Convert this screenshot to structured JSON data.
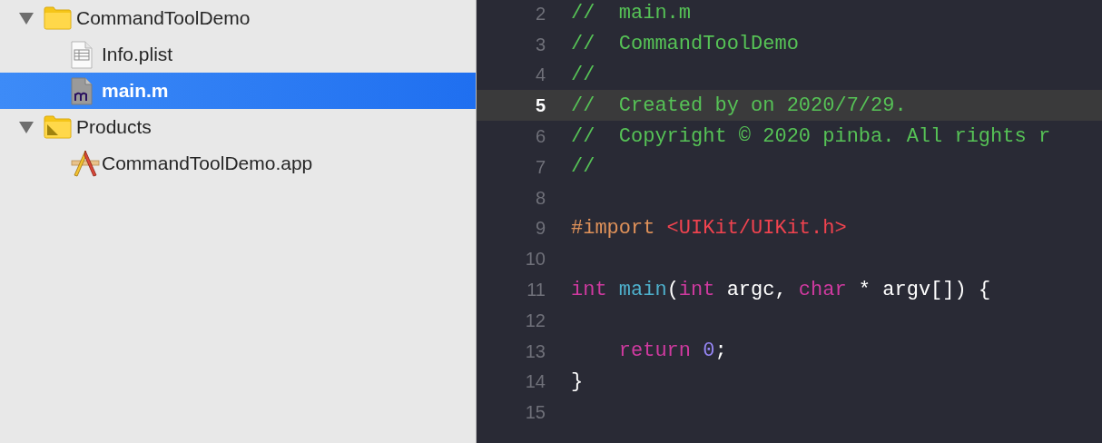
{
  "navigator": {
    "items": [
      {
        "name": "CommandToolDemo",
        "kind": "folder",
        "expanded": true,
        "selected": false,
        "children": [
          {
            "name": "Info.plist",
            "kind": "plist",
            "selected": false
          },
          {
            "name": "main.m",
            "kind": "source",
            "selected": true
          }
        ]
      },
      {
        "name": "Products",
        "kind": "products",
        "expanded": true,
        "selected": false,
        "children": [
          {
            "name": "CommandToolDemo.app",
            "kind": "app",
            "selected": false
          }
        ]
      }
    ]
  },
  "editor": {
    "lines": [
      {
        "number": "2",
        "current": false,
        "tokens": [
          {
            "kind": "comment",
            "text": "//  main.m"
          }
        ]
      },
      {
        "number": "3",
        "current": false,
        "tokens": [
          {
            "kind": "comment",
            "text": "//  CommandToolDemo"
          }
        ]
      },
      {
        "number": "4",
        "current": false,
        "tokens": [
          {
            "kind": "comment",
            "text": "//"
          }
        ]
      },
      {
        "number": "5",
        "current": true,
        "tokens": [
          {
            "kind": "comment",
            "text": "//  Created by on 2020/7/29."
          }
        ]
      },
      {
        "number": "6",
        "current": false,
        "tokens": [
          {
            "kind": "comment",
            "text": "//  Copyright © 2020 pinba. All rights r"
          }
        ]
      },
      {
        "number": "7",
        "current": false,
        "tokens": [
          {
            "kind": "comment",
            "text": "//"
          }
        ]
      },
      {
        "number": "8",
        "current": false
      },
      {
        "number": "9",
        "current": false,
        "tokens": [
          {
            "kind": "preprocessor",
            "text": "#import"
          },
          {
            "kind": "string",
            "text": " <UIKit/UIKit.h>"
          }
        ]
      },
      {
        "number": "10",
        "current": false
      },
      {
        "number": "11",
        "current": false,
        "tokens": [
          {
            "kind": "keyword",
            "text": "int"
          },
          {
            "kind": "function",
            "text": " main"
          },
          {
            "kind": "plain",
            "text": "("
          },
          {
            "kind": "keyword",
            "text": "int"
          },
          {
            "kind": "plain",
            "text": " argc, "
          },
          {
            "kind": "keyword",
            "text": "char"
          },
          {
            "kind": "plain",
            "text": " * argv[]) {"
          }
        ]
      },
      {
        "number": "12",
        "current": false
      },
      {
        "number": "13",
        "current": false,
        "tokens": [
          {
            "kind": "keyword",
            "text": "    return"
          },
          {
            "kind": "number",
            "text": " 0"
          },
          {
            "kind": "plain",
            "text": ";"
          }
        ]
      },
      {
        "number": "14",
        "current": false,
        "tokens": [
          {
            "kind": "plain",
            "text": "}"
          }
        ]
      },
      {
        "number": "15",
        "current": false
      }
    ]
  }
}
